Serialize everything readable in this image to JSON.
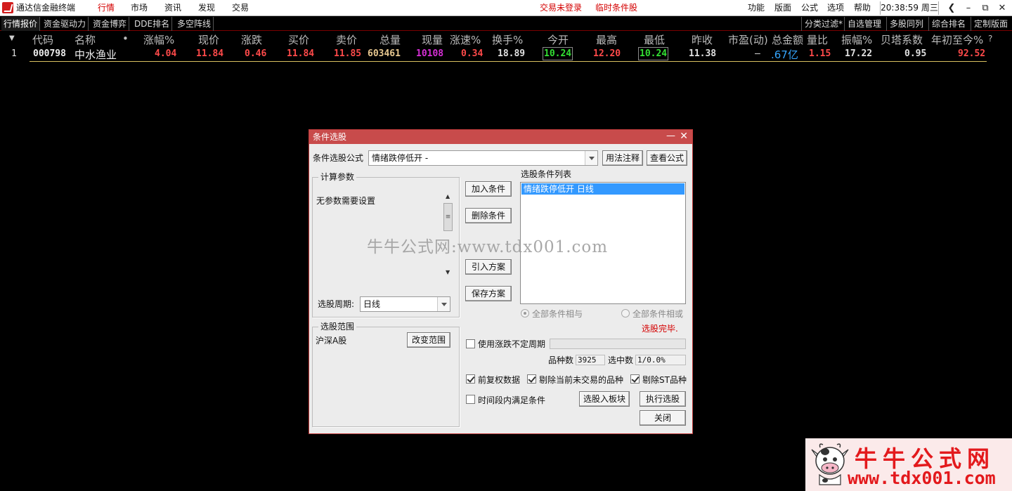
{
  "titlebar": {
    "app_title": "通达信金融终端",
    "menu": [
      "行情",
      "市场",
      "资讯",
      "发现",
      "交易"
    ],
    "status_login": "交易未登录",
    "status_temp": "临时条件股",
    "right_menu": [
      "功能",
      "版面",
      "公式",
      "选项",
      "帮助"
    ],
    "clock": "20:38:59 周三"
  },
  "tabs": {
    "left": [
      "行情报价",
      "资金驱动力",
      "资金博弈",
      "DDE排名",
      "多空阵线"
    ],
    "right": [
      "分类过滤*",
      "自选管理",
      "多股同列",
      "综合排名",
      "定制版面"
    ]
  },
  "table": {
    "headers": [
      "代码",
      "名称",
      "•",
      "涨幅%",
      "现价",
      "涨跌",
      "买价",
      "卖价",
      "总量",
      "现量",
      "涨速%",
      "换手%",
      "今开",
      "最高",
      "最低",
      "昨收",
      "市盈(动)",
      "总金额",
      "量比",
      "振幅%",
      "贝塔系数",
      "年初至今%",
      "?"
    ],
    "row": {
      "index": "1",
      "code": "000798",
      "name": "中水渔业",
      "change_pct": "4.04",
      "price": "11.84",
      "change": "0.46",
      "bid": "11.84",
      "ask": "11.85",
      "volume": "603461",
      "last_vol": "10108",
      "speed": "0.34",
      "turnover": "18.89",
      "open": "10.24",
      "high": "12.20",
      "low": "10.24",
      "prev_close": "11.38",
      "pe": "–",
      "amount": ".67亿",
      "vol_ratio": "1.15",
      "amplitude": "17.22",
      "beta": "0.95",
      "ytd": "92.52"
    }
  },
  "watermark": "牛牛公式网:www.tdx001.com",
  "dialog": {
    "title": "条件选股",
    "formula_label": "条件选股公式",
    "formula_value": "情绪跌停低开 -",
    "usage_button": "用法注释",
    "view_button": "查看公式",
    "params_group": "计算参数",
    "params_text": "无参数需要设置",
    "period_label": "选股周期:",
    "period_value": "日线",
    "range_group": "选股范围",
    "range_value": "沪深A股",
    "change_range_button": "改变范围",
    "add_button": "加入条件",
    "delete_button": "删除条件",
    "import_button": "引入方案",
    "save_button": "保存方案",
    "list_title": "选股条件列表",
    "list_items": [
      "情绪跌停低开  日线"
    ],
    "radio_and": "全部条件相与",
    "radio_or": "全部条件相或",
    "status": "选股完毕.",
    "use_variable_period": "使用涨跌不定周期",
    "count_label": "品种数",
    "count_value": "3925",
    "selected_label": "选中数",
    "selected_value": "1/0.0%",
    "opt_prior_adjust": "前复权数据",
    "opt_exclude_suspended": "剔除当前未交易的品种",
    "opt_exclude_st": "剔除ST品种",
    "opt_time_range": "时间段内满足条件",
    "to_block_button": "选股入板块",
    "run_button": "执行选股",
    "close_button": "关闭"
  },
  "brand": {
    "name": "牛牛公式网",
    "url": "www.tdx001.com"
  },
  "colors": {
    "up": "#ff4a4a",
    "neutral": "#e0e0e0",
    "volume": "#e8c890",
    "last_vol": "#d62fd6",
    "amount": "#35a6ff",
    "dialog_title": "#c84b4b",
    "list_select": "#3399ff"
  }
}
